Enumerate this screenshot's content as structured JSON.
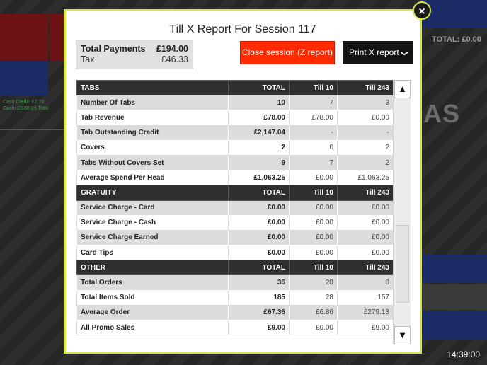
{
  "background": {
    "big_text": "AS",
    "total_label": "TOTAL: £0.00",
    "green_lines": [
      "Cash Credit: £7.70",
      "Cash: £0.00 (c) Total"
    ]
  },
  "clock": "14:39:00",
  "modal": {
    "title": "Till X Report For Session 117",
    "close_icon": "×",
    "summary": {
      "total_payments_label": "Total Payments",
      "total_payments_value": "£194.00",
      "tax_label": "Tax",
      "tax_value": "£46.33"
    },
    "close_session_button": "Close session (Z report)",
    "print_button": "Print X report",
    "print_chevron": "❯"
  },
  "table": {
    "sections": [
      {
        "header": [
          "TABS",
          "TOTAL",
          "Till 10",
          "Till 243"
        ],
        "rows": [
          [
            "Number Of Tabs",
            "10",
            "7",
            "3"
          ],
          [
            "Tab Revenue",
            "£78.00",
            "£78.00",
            "£0.00"
          ],
          [
            "Tab Outstanding Credit",
            "£2,147.04",
            "-",
            "-"
          ],
          [
            "Covers",
            "2",
            "0",
            "2"
          ],
          [
            "Tabs Without Covers Set",
            "9",
            "7",
            "2"
          ],
          [
            "Average Spend Per Head",
            "£1,063.25",
            "£0.00",
            "£1,063.25"
          ]
        ]
      },
      {
        "header": [
          "GRATUITY",
          "TOTAL",
          "Till 10",
          "Till 243"
        ],
        "rows": [
          [
            "Service Charge - Card",
            "£0.00",
            "£0.00",
            "£0.00"
          ],
          [
            "Service Charge - Cash",
            "£0.00",
            "£0.00",
            "£0.00"
          ],
          [
            "Service Charge Earned",
            "£0.00",
            "£0.00",
            "£0.00"
          ],
          [
            "Card Tips",
            "£0.00",
            "£0.00",
            "£0.00"
          ]
        ]
      },
      {
        "header": [
          "OTHER",
          "TOTAL",
          "Till 10",
          "Till 243"
        ],
        "rows": [
          [
            "Total Orders",
            "36",
            "28",
            "8"
          ],
          [
            "Total Items Sold",
            "185",
            "28",
            "157"
          ],
          [
            "Average Order",
            "£67.36",
            "£6.86",
            "£279.13"
          ],
          [
            "All Promo Sales",
            "£9.00",
            "£0.00",
            "£9.00"
          ]
        ]
      }
    ]
  },
  "scroll": {
    "up_icon": "▲",
    "down_icon": "▼"
  },
  "colors": {
    "accent": "#d6e64a",
    "danger": "#ff2a00",
    "header_bg": "#2f2f2f"
  }
}
